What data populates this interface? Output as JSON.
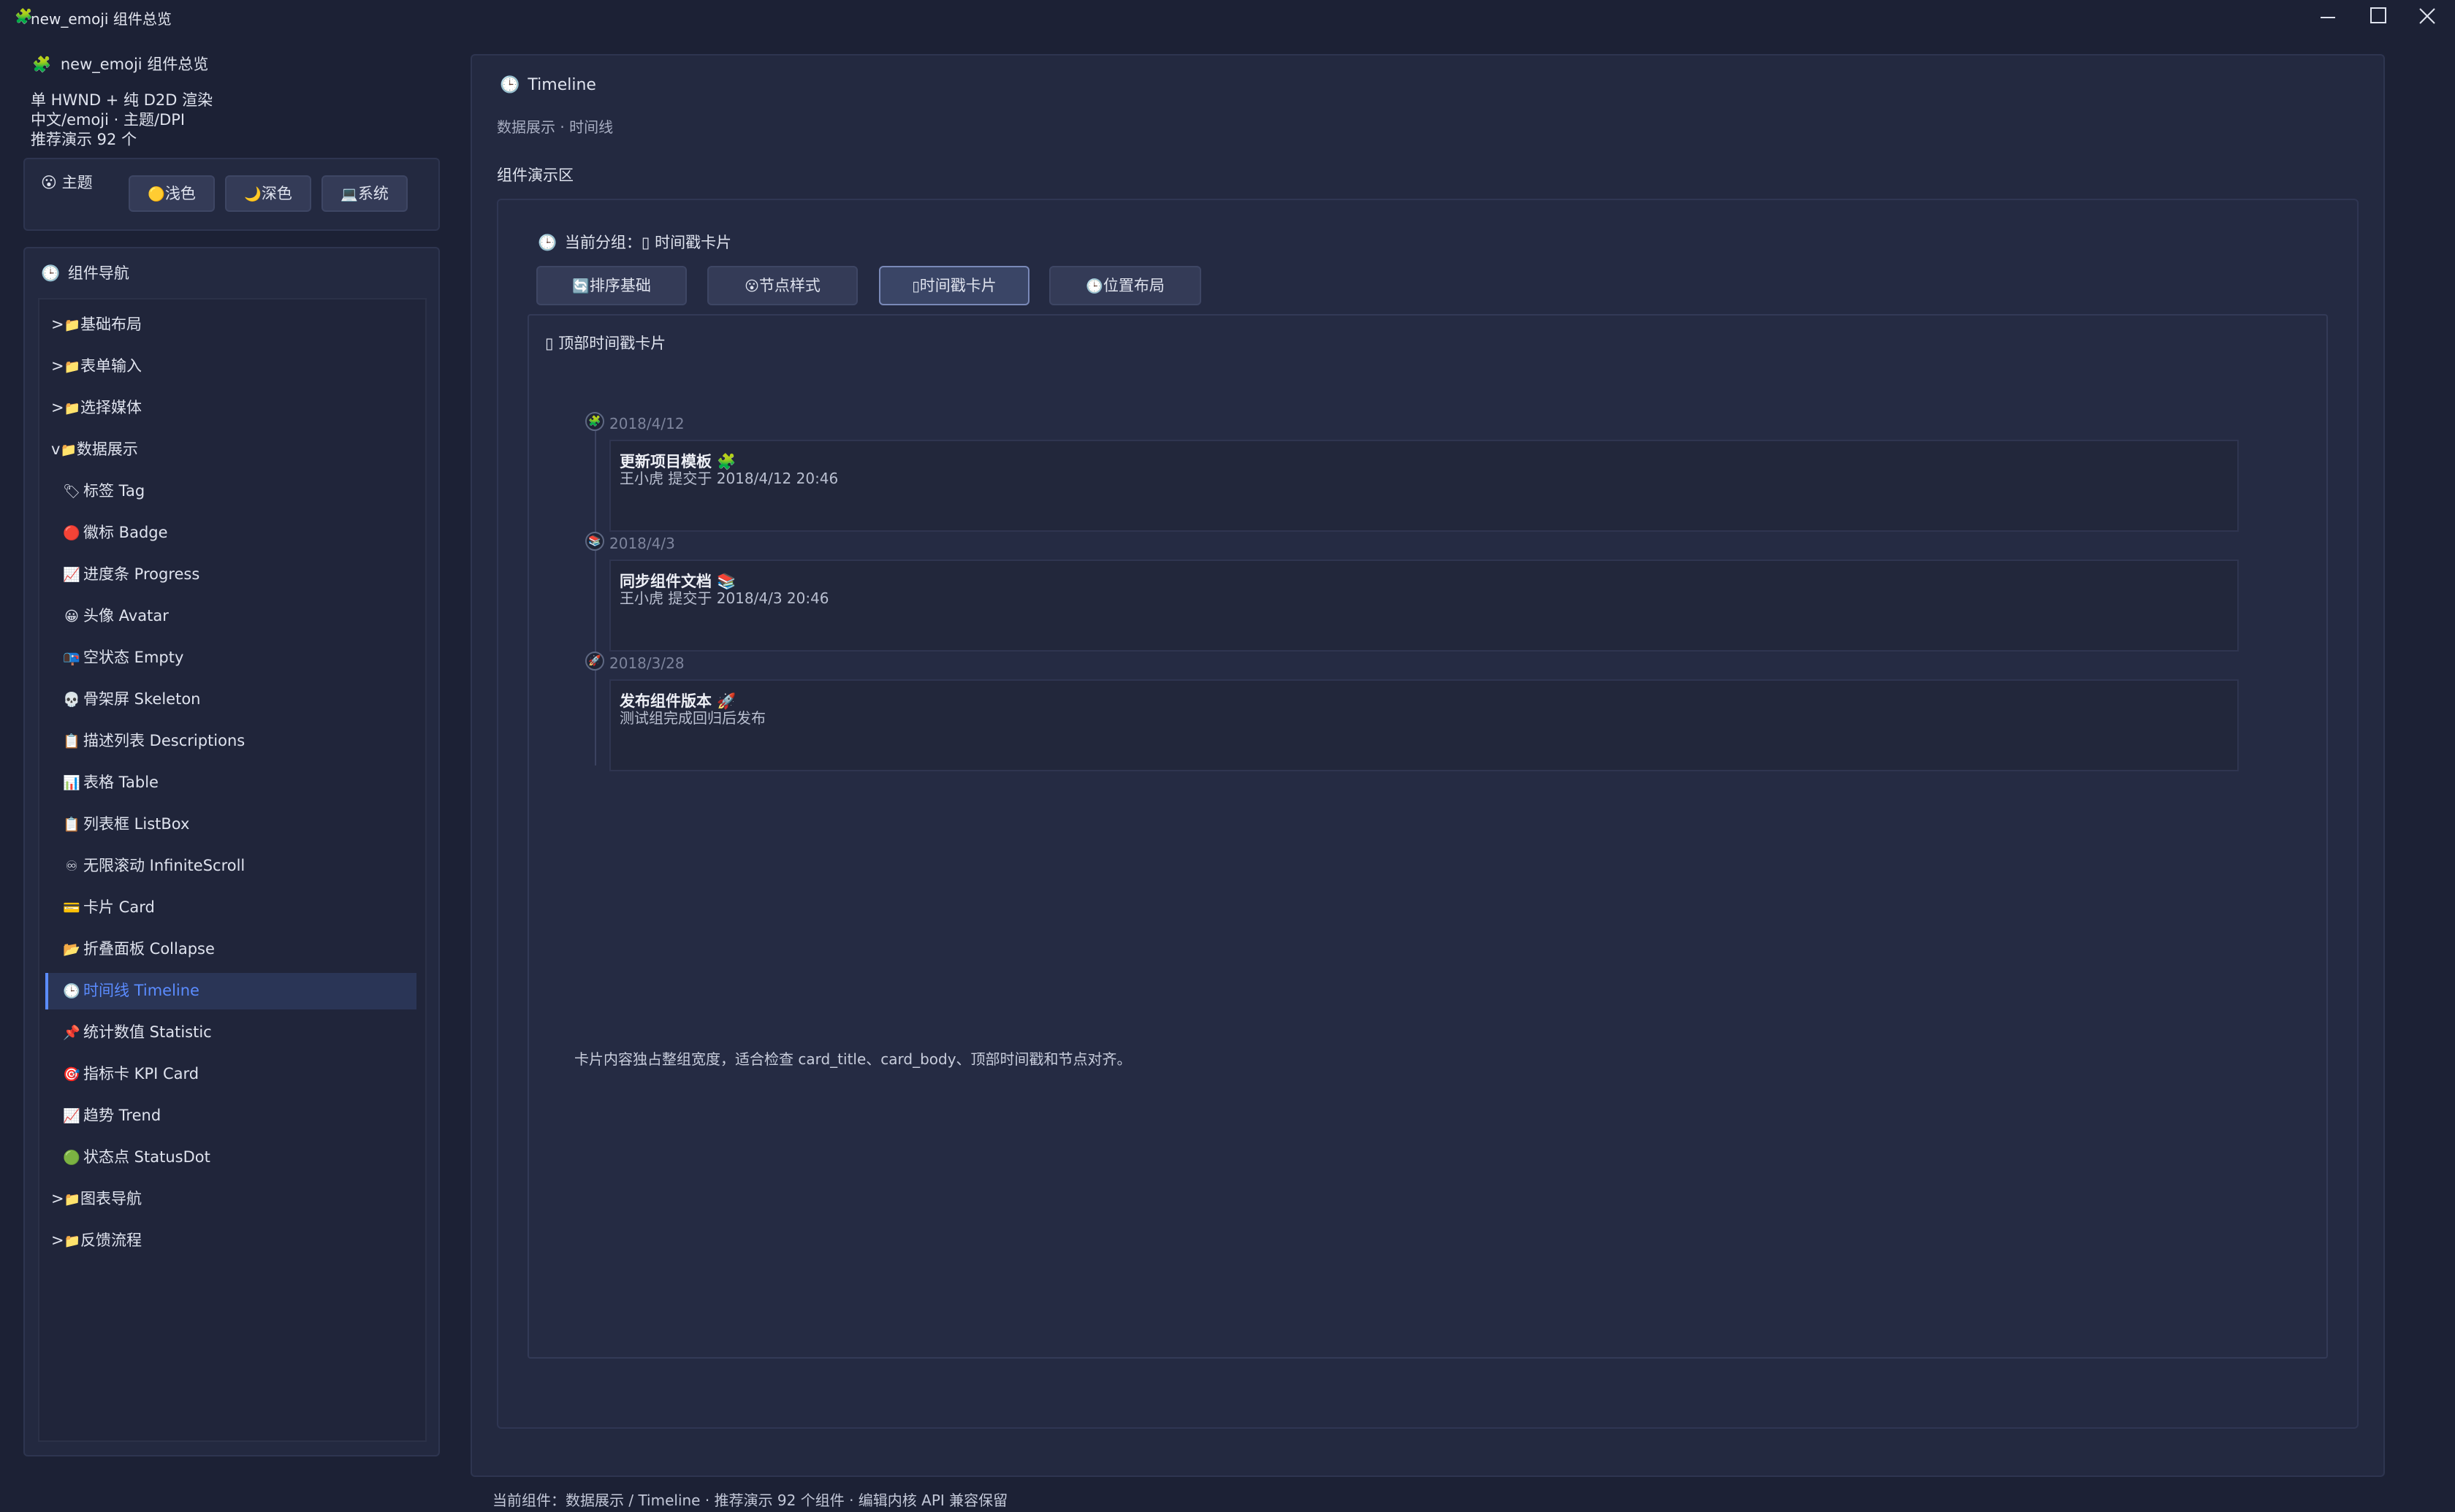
{
  "window": {
    "title": "new_emoji 组件总览",
    "app_icon": "puzzle-icon"
  },
  "sidebar": {
    "app_title": "new_emoji 组件总览",
    "info_lines": [
      "单 HWND + 纯 D2D 渲染",
      "中文/emoji · 主题/DPI",
      "推荐演示 92 个"
    ],
    "theme": {
      "label": "主题",
      "options": [
        {
          "icon": "🟡",
          "label": "浅色"
        },
        {
          "icon": "🌙",
          "label": "深色"
        },
        {
          "icon": "💻",
          "label": "系统"
        }
      ]
    },
    "nav": {
      "label": "组件导航",
      "groups_top": [
        {
          "prefix": ">",
          "label": "基础布局"
        },
        {
          "prefix": ">",
          "label": "表单输入"
        },
        {
          "prefix": ">",
          "label": "选择媒体"
        },
        {
          "prefix": "v",
          "label": "数据展示"
        }
      ],
      "items": [
        {
          "icon": "🏷",
          "label": "标签 Tag"
        },
        {
          "icon": "🔴",
          "label": "徽标 Badge"
        },
        {
          "icon": "📈",
          "label": "进度条 Progress"
        },
        {
          "icon": "😀",
          "label": "头像 Avatar"
        },
        {
          "icon": "📭",
          "label": "空状态 Empty"
        },
        {
          "icon": "💀",
          "label": "骨架屏 Skeleton"
        },
        {
          "icon": "📋",
          "label": "描述列表 Descriptions"
        },
        {
          "icon": "📊",
          "label": "表格 Table"
        },
        {
          "icon": "📋",
          "label": "列表框 ListBox"
        },
        {
          "icon": "♾",
          "label": "无限滚动 InfiniteScroll"
        },
        {
          "icon": "💳",
          "label": "卡片 Card"
        },
        {
          "icon": "📂",
          "label": "折叠面板 Collapse"
        },
        {
          "icon": "🕒",
          "label": "时间线 Timeline"
        },
        {
          "icon": "📌",
          "label": "统计数值 Statistic"
        },
        {
          "icon": "🎯",
          "label": "指标卡 KPI Card"
        },
        {
          "icon": "📈",
          "label": "趋势 Trend"
        },
        {
          "icon": "🟢",
          "label": "状态点 StatusDot"
        }
      ],
      "groups_bottom": [
        {
          "prefix": ">",
          "label": "图表导航"
        },
        {
          "prefix": ">",
          "label": "反馈流程"
        }
      ],
      "selected_index": 12
    }
  },
  "main": {
    "title": "Timeline",
    "subtitle": "数据展示 · 时间线",
    "demo_label": "组件演示区",
    "current_group": "当前分组：▯ 时间戳卡片",
    "tabs": [
      {
        "icon": "🔄",
        "label": "排序基础"
      },
      {
        "icon": "😮",
        "label": "节点样式"
      },
      {
        "icon": "▯",
        "label": "时间戳卡片"
      },
      {
        "icon": "🕒",
        "label": "位置布局"
      }
    ],
    "active_tab": 2,
    "section_title": "▯ 顶部时间戳卡片",
    "timeline": [
      {
        "node_icon": "🧩",
        "date": "2018/4/12",
        "title": "更新项目模板 🧩",
        "body": "王小虎 提交于 2018/4/12 20:46"
      },
      {
        "node_icon": "📚",
        "date": "2018/4/3",
        "title": "同步组件文档 📚",
        "body": "王小虎 提交于 2018/4/3 20:46"
      },
      {
        "node_icon": "🚀",
        "date": "2018/3/28",
        "title": "发布组件版本 🚀",
        "body": "测试组完成回归后发布"
      }
    ],
    "note": "卡片内容独占整组宽度，适合检查 card_title、card_body、顶部时间戳和节点对齐。",
    "status_bar": "当前组件：数据展示 / Timeline · 推荐演示 92 个组件 · 编辑内核 API 兼容保留"
  },
  "colors": {
    "background": "#1c2135",
    "panel": "#232940",
    "accent": "#5b8cff",
    "selected_bg": "#2a3556"
  }
}
